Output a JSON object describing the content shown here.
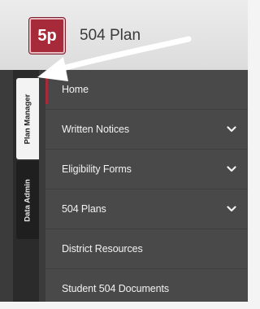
{
  "header": {
    "logo_text": "5p",
    "title": "504 Plan"
  },
  "tabs": [
    {
      "label": "Plan Manager",
      "active": true
    },
    {
      "label": "Data Admin",
      "active": false
    }
  ],
  "menu": [
    {
      "label": "Home",
      "has_chevron": false,
      "current": true
    },
    {
      "label": "Written Notices",
      "has_chevron": true
    },
    {
      "label": "Eligibility Forms",
      "has_chevron": true
    },
    {
      "label": "504 Plans",
      "has_chevron": true
    },
    {
      "label": "District Resources",
      "has_chevron": false
    },
    {
      "label": "Student 504 Documents",
      "has_chevron": false
    }
  ],
  "colors": {
    "brand": "#a72a3a",
    "menu_bg": "#494949",
    "tab_rail": "#2b2b2b"
  },
  "annotation": {
    "icon": "arrow-pointer-icon",
    "color": "#ffffff"
  }
}
